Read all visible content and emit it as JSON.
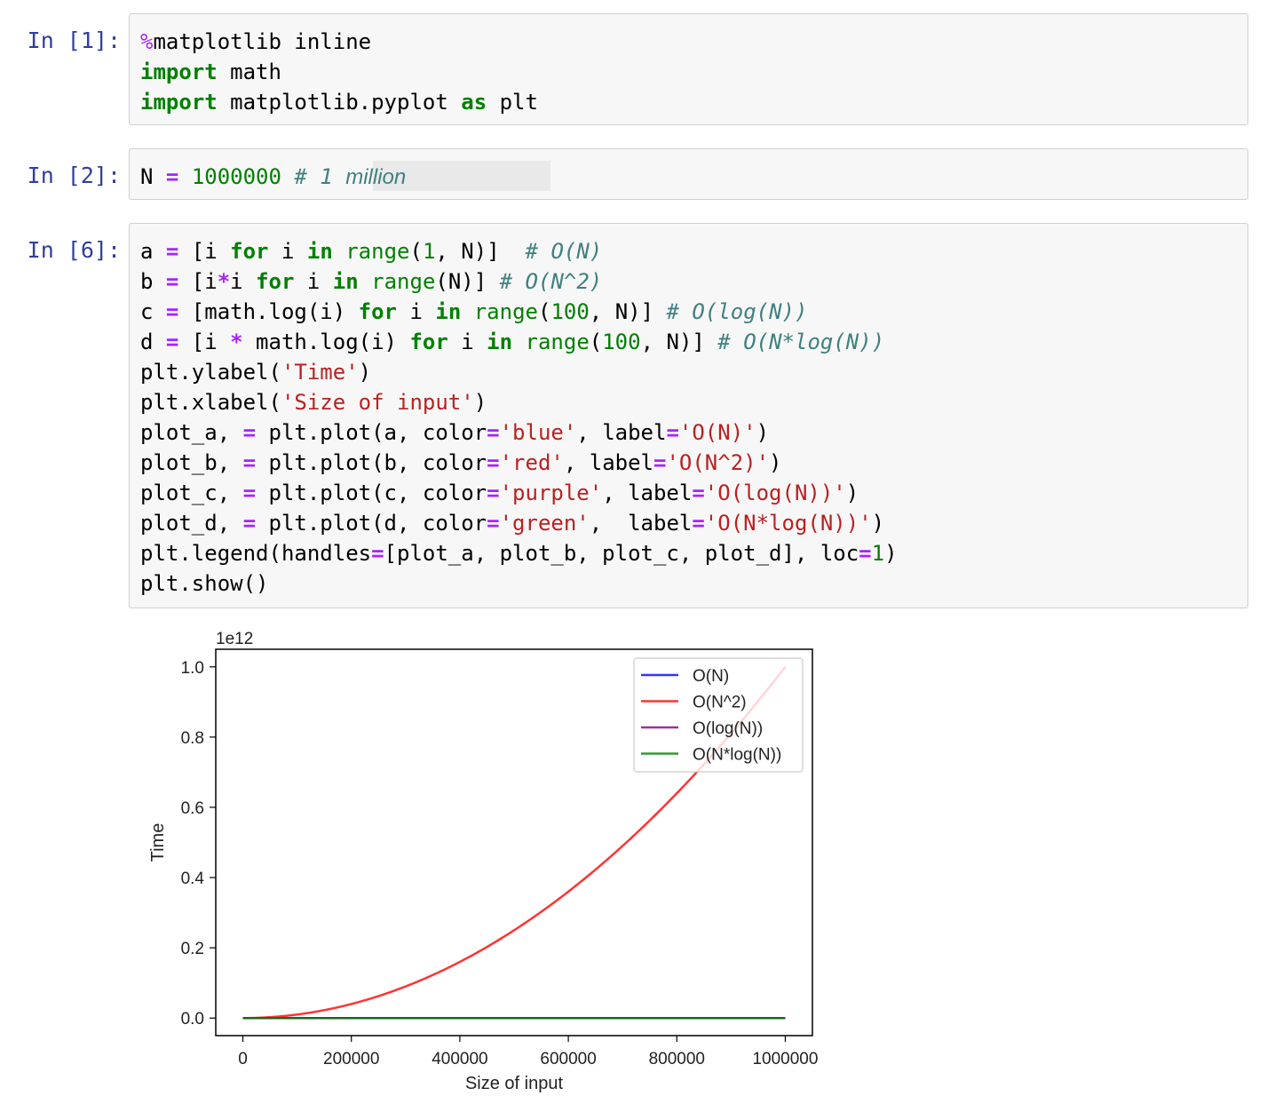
{
  "cells": [
    {
      "prompt": "In [1]:",
      "lines": [
        [
          {
            "t": "%",
            "c": "magic"
          },
          {
            "t": "matplotlib inline",
            "c": ""
          }
        ],
        [
          {
            "t": "import",
            "c": "kw"
          },
          {
            "t": " math",
            "c": ""
          }
        ],
        [
          {
            "t": "import",
            "c": "kw"
          },
          {
            "t": " matplotlib.pyplot ",
            "c": ""
          },
          {
            "t": "as",
            "c": "kw"
          },
          {
            "t": " plt",
            "c": ""
          }
        ]
      ]
    },
    {
      "prompt": "In [2]:",
      "lines": [
        [
          {
            "t": "N ",
            "c": ""
          },
          {
            "t": "=",
            "c": "op"
          },
          {
            "t": " ",
            "c": ""
          },
          {
            "t": "1000000",
            "c": "num"
          },
          {
            "t": " ",
            "c": ""
          },
          {
            "t": "# 1 ",
            "c": "cm"
          },
          {
            "t": "million",
            "c": "cm sans-italic"
          }
        ]
      ]
    },
    {
      "prompt": "In [6]:",
      "lines": [
        [
          {
            "t": "a ",
            "c": ""
          },
          {
            "t": "=",
            "c": "op"
          },
          {
            "t": " [i ",
            "c": ""
          },
          {
            "t": "for",
            "c": "kw"
          },
          {
            "t": " i ",
            "c": ""
          },
          {
            "t": "in",
            "c": "kw"
          },
          {
            "t": " ",
            "c": ""
          },
          {
            "t": "range",
            "c": "bi"
          },
          {
            "t": "(",
            "c": ""
          },
          {
            "t": "1",
            "c": "num"
          },
          {
            "t": ", N)]  ",
            "c": ""
          },
          {
            "t": "# O(N)",
            "c": "cm"
          }
        ],
        [
          {
            "t": "b ",
            "c": ""
          },
          {
            "t": "=",
            "c": "op"
          },
          {
            "t": " [i",
            "c": ""
          },
          {
            "t": "*",
            "c": "op"
          },
          {
            "t": "i ",
            "c": ""
          },
          {
            "t": "for",
            "c": "kw"
          },
          {
            "t": " i ",
            "c": ""
          },
          {
            "t": "in",
            "c": "kw"
          },
          {
            "t": " ",
            "c": ""
          },
          {
            "t": "range",
            "c": "bi"
          },
          {
            "t": "(N)] ",
            "c": ""
          },
          {
            "t": "# O(N^2)",
            "c": "cm"
          }
        ],
        [
          {
            "t": "c ",
            "c": ""
          },
          {
            "t": "=",
            "c": "op"
          },
          {
            "t": " [math.log(i) ",
            "c": ""
          },
          {
            "t": "for",
            "c": "kw"
          },
          {
            "t": " i ",
            "c": ""
          },
          {
            "t": "in",
            "c": "kw"
          },
          {
            "t": " ",
            "c": ""
          },
          {
            "t": "range",
            "c": "bi"
          },
          {
            "t": "(",
            "c": ""
          },
          {
            "t": "100",
            "c": "num"
          },
          {
            "t": ", N)] ",
            "c": ""
          },
          {
            "t": "# O(log(N))",
            "c": "cm"
          }
        ],
        [
          {
            "t": "d ",
            "c": ""
          },
          {
            "t": "=",
            "c": "op"
          },
          {
            "t": " [i ",
            "c": ""
          },
          {
            "t": "*",
            "c": "op"
          },
          {
            "t": " math.log(i) ",
            "c": ""
          },
          {
            "t": "for",
            "c": "kw"
          },
          {
            "t": " i ",
            "c": ""
          },
          {
            "t": "in",
            "c": "kw"
          },
          {
            "t": " ",
            "c": ""
          },
          {
            "t": "range",
            "c": "bi"
          },
          {
            "t": "(",
            "c": ""
          },
          {
            "t": "100",
            "c": "num"
          },
          {
            "t": ", N)] ",
            "c": ""
          },
          {
            "t": "# O(N*log(N))",
            "c": "cm"
          }
        ],
        [
          {
            "t": "plt.ylabel(",
            "c": ""
          },
          {
            "t": "'Time'",
            "c": "str"
          },
          {
            "t": ")",
            "c": ""
          }
        ],
        [
          {
            "t": "plt.xlabel(",
            "c": ""
          },
          {
            "t": "'Size of input'",
            "c": "str"
          },
          {
            "t": ")",
            "c": ""
          }
        ],
        [
          {
            "t": "plot_a, ",
            "c": ""
          },
          {
            "t": "=",
            "c": "op"
          },
          {
            "t": " plt.plot(a, color",
            "c": ""
          },
          {
            "t": "=",
            "c": "op"
          },
          {
            "t": "'blue'",
            "c": "str"
          },
          {
            "t": ", label",
            "c": ""
          },
          {
            "t": "=",
            "c": "op"
          },
          {
            "t": "'O(N)'",
            "c": "str"
          },
          {
            "t": ")",
            "c": ""
          }
        ],
        [
          {
            "t": "plot_b, ",
            "c": ""
          },
          {
            "t": "=",
            "c": "op"
          },
          {
            "t": " plt.plot(b, color",
            "c": ""
          },
          {
            "t": "=",
            "c": "op"
          },
          {
            "t": "'red'",
            "c": "str"
          },
          {
            "t": ", label",
            "c": ""
          },
          {
            "t": "=",
            "c": "op"
          },
          {
            "t": "'O(N^2)'",
            "c": "str"
          },
          {
            "t": ")",
            "c": ""
          }
        ],
        [
          {
            "t": "plot_c, ",
            "c": ""
          },
          {
            "t": "=",
            "c": "op"
          },
          {
            "t": " plt.plot(c, color",
            "c": ""
          },
          {
            "t": "=",
            "c": "op"
          },
          {
            "t": "'purple'",
            "c": "str"
          },
          {
            "t": ", label",
            "c": ""
          },
          {
            "t": "=",
            "c": "op"
          },
          {
            "t": "'O(log(N))'",
            "c": "str"
          },
          {
            "t": ")",
            "c": ""
          }
        ],
        [
          {
            "t": "plot_d, ",
            "c": ""
          },
          {
            "t": "=",
            "c": "op"
          },
          {
            "t": " plt.plot(d, color",
            "c": ""
          },
          {
            "t": "=",
            "c": "op"
          },
          {
            "t": "'green'",
            "c": "str"
          },
          {
            "t": ",  label",
            "c": ""
          },
          {
            "t": "=",
            "c": "op"
          },
          {
            "t": "'O(N*log(N))'",
            "c": "str"
          },
          {
            "t": ")",
            "c": ""
          }
        ],
        [
          {
            "t": "plt.legend(handles",
            "c": ""
          },
          {
            "t": "=",
            "c": "op"
          },
          {
            "t": "[plot_a, plot_b, plot_c, plot_d], loc",
            "c": ""
          },
          {
            "t": "=",
            "c": "op"
          },
          {
            "t": "1",
            "c": "num"
          },
          {
            "t": ")",
            "c": ""
          }
        ],
        [
          {
            "t": "plt.show()",
            "c": ""
          }
        ]
      ]
    }
  ],
  "chart_data": {
    "type": "line",
    "xlabel": "Size of input",
    "ylabel": "Time",
    "y_offset_label": "1e12",
    "xlim": [
      -50000,
      1050000
    ],
    "ylim": [
      -0.05,
      1.05
    ],
    "y_scale": 1000000000000.0,
    "x_ticks": [
      0,
      200000,
      400000,
      600000,
      800000,
      1000000
    ],
    "x_tick_labels": [
      "0",
      "200000",
      "400000",
      "600000",
      "800000",
      "1000000"
    ],
    "y_ticks": [
      0.0,
      0.2,
      0.4,
      0.6,
      0.8,
      1.0
    ],
    "y_tick_labels": [
      "0.0",
      "0.2",
      "0.4",
      "0.6",
      "0.8",
      "1.0"
    ],
    "grid": false,
    "legend_position": "top-right",
    "series": [
      {
        "name": "O(N)",
        "color": "#0000ff",
        "formula": "linear",
        "x": [
          0,
          1000000
        ],
        "y": [
          0,
          1e-06
        ]
      },
      {
        "name": "O(N^2)",
        "color": "#ff0000",
        "formula": "square",
        "x": [
          0,
          100000,
          200000,
          300000,
          400000,
          500000,
          600000,
          700000,
          800000,
          900000,
          1000000
        ],
        "y": [
          0,
          0.01,
          0.04,
          0.09,
          0.16,
          0.25,
          0.36,
          0.49,
          0.64,
          0.81,
          1.0
        ]
      },
      {
        "name": "O(log(N))",
        "color": "#800080",
        "formula": "log",
        "x": [
          0,
          1000000
        ],
        "y": [
          0,
          0
        ]
      },
      {
        "name": "O(N*log(N))",
        "color": "#008000",
        "formula": "nlogn",
        "x": [
          0,
          1000000
        ],
        "y": [
          0,
          1.38e-05
        ]
      }
    ]
  }
}
